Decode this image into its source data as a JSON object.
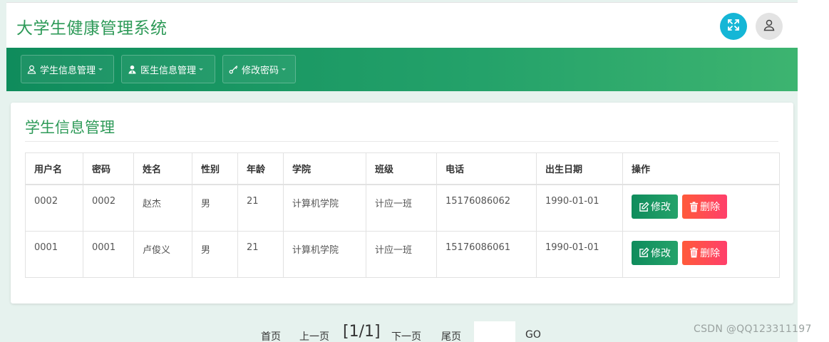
{
  "app": {
    "title": "大学生健康管理系统"
  },
  "header": {
    "fullscreen_icon": "expand-icon",
    "user_icon": "user-icon"
  },
  "nav": {
    "items": [
      {
        "label": "学生信息管理",
        "icon": "user-outline-icon"
      },
      {
        "label": "医生信息管理",
        "icon": "doctor-icon"
      },
      {
        "label": "修改密码",
        "icon": "key-icon"
      }
    ]
  },
  "panel": {
    "title": "学生信息管理"
  },
  "table": {
    "columns": [
      "用户名",
      "密码",
      "姓名",
      "性别",
      "年龄",
      "学院",
      "班级",
      "电话",
      "出生日期",
      "操作"
    ],
    "rows": [
      {
        "username": "0002",
        "password": "0002",
        "name": "赵杰",
        "gender": "男",
        "age": "21",
        "college": "计算机学院",
        "class": "计应一班",
        "phone": "15176086062",
        "birth": "1990-01-01"
      },
      {
        "username": "0001",
        "password": "0001",
        "name": "卢俊义",
        "gender": "男",
        "age": "21",
        "college": "计算机学院",
        "class": "计应一班",
        "phone": "15176086061",
        "birth": "1990-01-01"
      }
    ],
    "edit_label": "修改",
    "delete_label": "删除"
  },
  "pager": {
    "first": "首页",
    "prev": "上一页",
    "info": "[1/1]",
    "next": "下一页",
    "last": "尾页",
    "go": "GO",
    "input_value": ""
  },
  "watermark": "CSDN @QQ123311197",
  "colors": {
    "brand_green": "#2e9a58",
    "nav_gradient_start": "#0f8c5c",
    "nav_gradient_end": "#3db470",
    "fullscreen_btn": "#15b6d6",
    "delete_btn": "#ff4a55"
  }
}
